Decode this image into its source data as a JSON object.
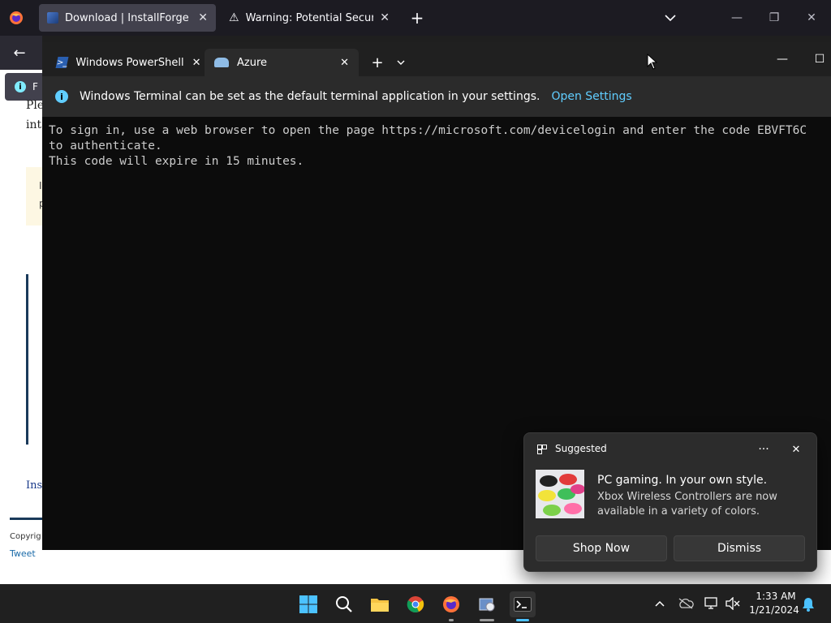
{
  "browser": {
    "tabs": [
      {
        "label": "Download | InstallForge"
      },
      {
        "label": "Warning: Potential Security Risk"
      }
    ],
    "notification_fragment": "F",
    "page_fragments": {
      "line1": "Ple",
      "line2": "int",
      "box1": "I",
      "box2": "p",
      "link": "Inst",
      "copyright": "Copyrig",
      "tweet": "Tweet"
    }
  },
  "terminal": {
    "tabs": [
      {
        "label": "Windows PowerShell"
      },
      {
        "label": "Azure"
      }
    ],
    "infobar": {
      "message": "Windows Terminal can be set as the default terminal application in your settings.",
      "link": "Open Settings"
    },
    "output": "To sign in, use a web browser to open the page https://microsoft.com/devicelogin and enter the code EBVFT6C\nto authenticate.\nThis code will expire in 15 minutes."
  },
  "toast": {
    "header": "Suggested",
    "title": "PC gaming. In your own style.",
    "body": "Xbox Wireless Controllers are now available in a variety of colors.",
    "primary_button": "Shop Now",
    "secondary_button": "Dismiss"
  },
  "taskbar": {
    "time": "1:33 AM",
    "date": "1/21/2024"
  },
  "colors": {
    "accent": "#0078d4",
    "link": "#60cdff",
    "terminal_bg": "#0c0c0c"
  }
}
